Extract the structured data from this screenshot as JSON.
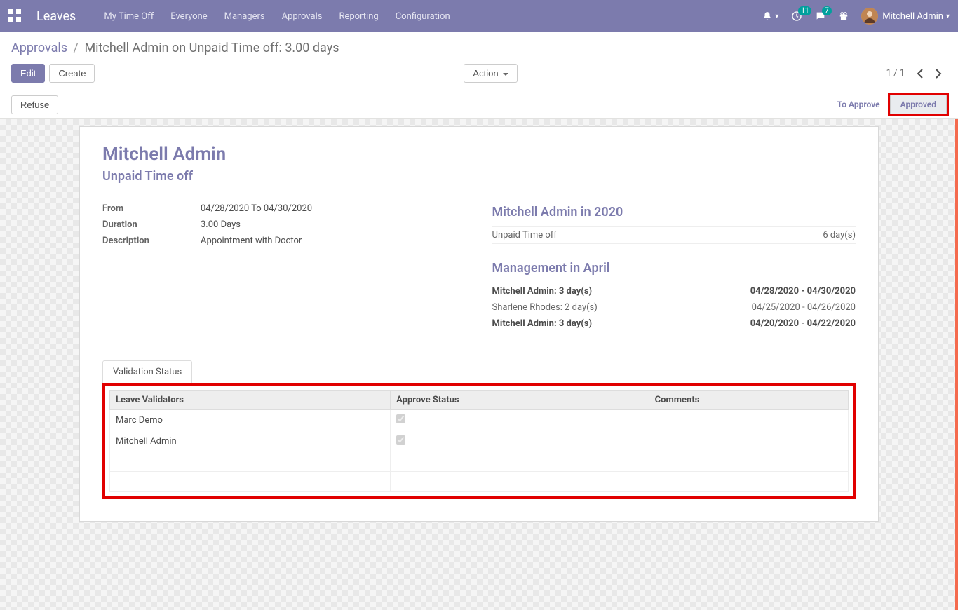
{
  "navbar": {
    "brand": "Leaves",
    "menu": [
      "My Time Off",
      "Everyone",
      "Managers",
      "Approvals",
      "Reporting",
      "Configuration"
    ],
    "activity_badge": "11",
    "messages_badge": "7",
    "user_name": "Mitchell Admin"
  },
  "breadcrumbs": {
    "link": "Approvals",
    "current": "Mitchell Admin on Unpaid Time off: 3.00 days"
  },
  "buttons": {
    "edit": "Edit",
    "create": "Create",
    "action": "Action",
    "refuse": "Refuse"
  },
  "pager": {
    "text": "1 / 1"
  },
  "status": {
    "to_approve": "To Approve",
    "approved": "Approved"
  },
  "form": {
    "title": "Mitchell Admin",
    "subtitle": "Unpaid Time off",
    "fields": {
      "from_label": "From",
      "from_value": "04/28/2020 To 04/30/2020",
      "duration_label": "Duration",
      "duration_value": "3.00  Days",
      "description_label": "Description",
      "description_value": "Appointment with Doctor"
    },
    "year_summary": {
      "title": "Mitchell Admin in 2020",
      "rows": [
        {
          "left": "Unpaid Time off",
          "right": "6 day(s)",
          "bold": false
        }
      ]
    },
    "month_summary": {
      "title": "Management in April",
      "rows": [
        {
          "left": "Mitchell Admin: 3 day(s)",
          "right": "04/28/2020 - 04/30/2020",
          "bold": true
        },
        {
          "left": "Sharlene Rhodes: 2 day(s)",
          "right": "04/25/2020 - 04/26/2020",
          "bold": false
        },
        {
          "left": "Mitchell Admin: 3 day(s)",
          "right": "04/20/2020 - 04/22/2020",
          "bold": true
        }
      ]
    }
  },
  "tabs": {
    "validation": "Validation Status"
  },
  "validation_table": {
    "headers": [
      "Leave Validators",
      "Approve Status",
      "Comments"
    ],
    "rows": [
      {
        "name": "Marc Demo",
        "approved": true,
        "comment": ""
      },
      {
        "name": "Mitchell Admin",
        "approved": true,
        "comment": ""
      }
    ]
  }
}
